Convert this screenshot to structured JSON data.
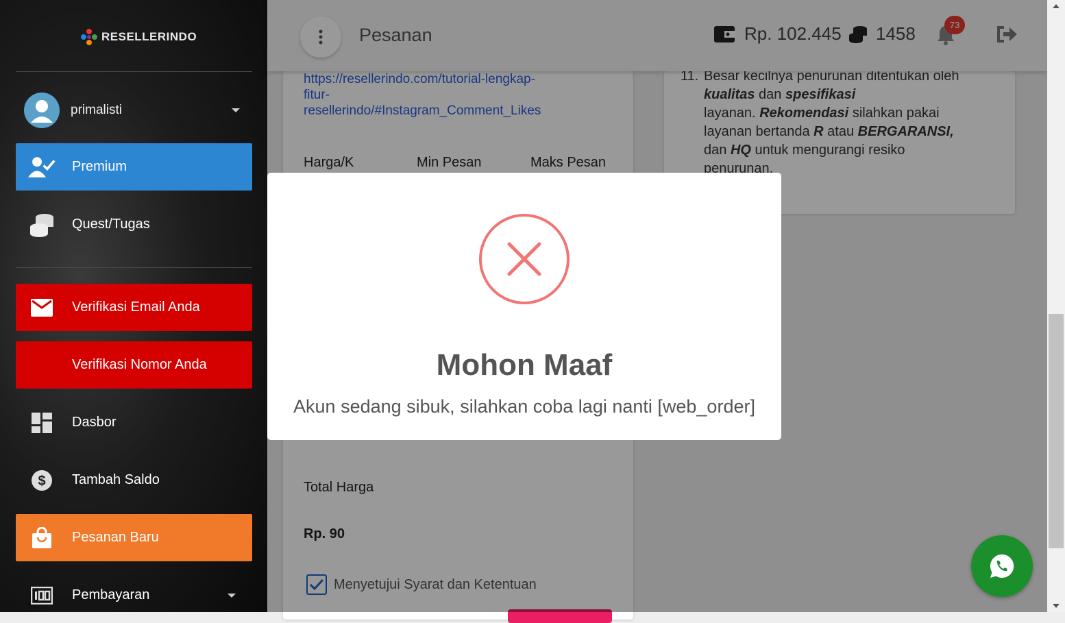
{
  "brand": {
    "name": "RESELLERINDO"
  },
  "user": {
    "name": "primalisti"
  },
  "sidebar": {
    "items": [
      {
        "label": "Premium",
        "icon": "user-check-icon",
        "bg": "#2d86d2"
      },
      {
        "label": "Quest/Tugas",
        "icon": "coins-icon",
        "bg": "transparent"
      },
      {
        "label": "Verifikasi Email Anda",
        "icon": "email-icon",
        "bg": "#d50000"
      },
      {
        "label": "Verifikasi Nomor Anda",
        "icon": "",
        "bg": "#d50000"
      },
      {
        "label": "Dasbor",
        "icon": "dashboard-icon",
        "bg": "transparent"
      },
      {
        "label": "Tambah Saldo",
        "icon": "dollar-icon",
        "bg": "transparent"
      },
      {
        "label": "Pesanan Baru",
        "icon": "shopping-bag-icon",
        "bg": "#f0792a"
      },
      {
        "label": "Pembayaran",
        "icon": "payment-icon",
        "bg": "transparent"
      }
    ]
  },
  "header": {
    "title": "Pesanan",
    "balance": "Rp. 102.445",
    "coins": "1458",
    "notifications": "73"
  },
  "order": {
    "tutorial_link": "https://resellerindo.com/tutorial-lengkap-fitur-resellerindo/#Instagram_Comment_Likes",
    "link_line1": "https://resellerindo.com/tutorial-lengkap-",
    "link_line2": "fitur-",
    "link_line3": "resellerindo/#Instagram_Comment_Likes",
    "columns": [
      "Harga/K",
      "Min Pesan",
      "Maks Pesan"
    ],
    "total_label": "Total Harga",
    "total_value": "Rp. 90",
    "agree_label": "Menyetujui Syarat dan Ketentuan",
    "agree_checked": true
  },
  "terms": {
    "number": "11.",
    "line1": "Besar kecilnya penurunan ditentukan oleh",
    "kualitas": "kualitas",
    "dan1": "dan",
    "spesifikasi": "spesifikasi",
    "layanan": "layanan.",
    "rekomendasi": "Rekomendasi",
    "rest1": "silahkan pakai",
    "line4a": "layanan bertanda",
    "r": "R",
    "atau": "atau",
    "bergaransi": "BERGARANSI,",
    "dan2": "dan",
    "hq": "HQ",
    "rest2": "untuk mengurangi resiko",
    "line6": "penurunan."
  },
  "modal": {
    "title": "Mohon Maaf",
    "message": "Akun sedang sibuk, silahkan coba lagi nanti [web_order]",
    "icon": "error-x-icon",
    "icon_color": "#f27474"
  },
  "colors": {
    "premium": "#2d86d2",
    "verify": "#d50000",
    "new_order": "#f0792a",
    "whatsapp": "#1b8f2c",
    "badge": "#e53935"
  }
}
